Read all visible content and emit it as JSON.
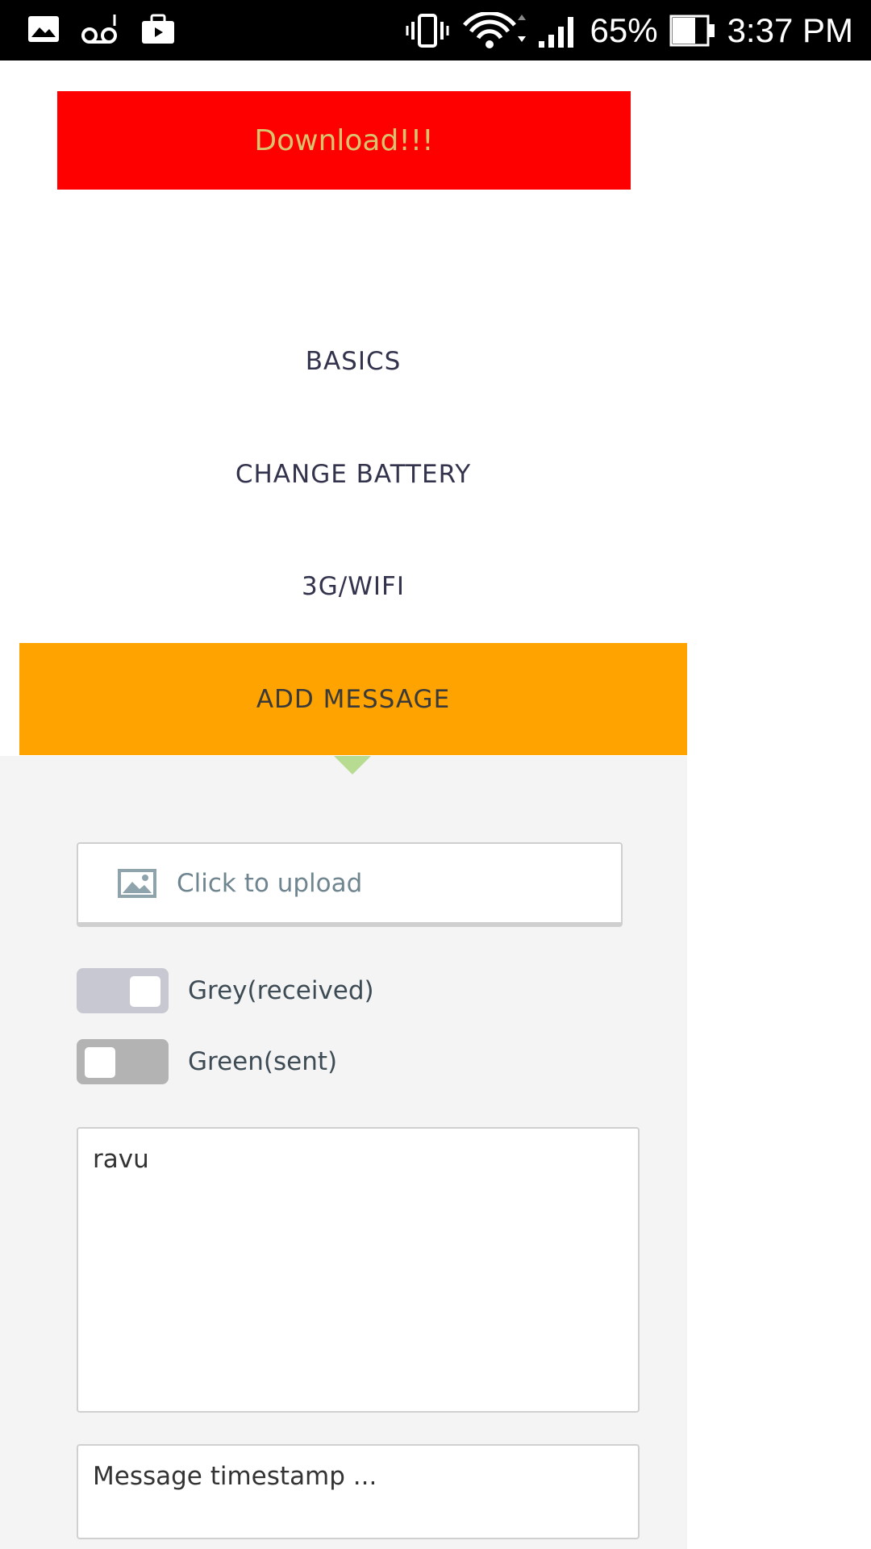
{
  "status_bar": {
    "icons_left": [
      "gallery-icon",
      "voicemail-icon",
      "briefcase-icon"
    ],
    "icons_right": [
      "vibrate-icon",
      "wifi-icon",
      "signal-icon",
      "battery-icon"
    ],
    "battery_percent": "65%",
    "time": "3:37 PM"
  },
  "download_button": {
    "label": "Download!!!",
    "background": "#ff0000",
    "text_color": "#d9c36f"
  },
  "menu": {
    "items": [
      {
        "label": "BASICS",
        "active": false
      },
      {
        "label": "CHANGE BATTERY",
        "active": false
      },
      {
        "label": "3G/WIFI",
        "active": false
      },
      {
        "label": "ADD MESSAGE",
        "active": true
      }
    ],
    "active_color": "#ffa300"
  },
  "add_message_panel": {
    "upload": {
      "label": "Click to upload",
      "icon": "image-icon"
    },
    "toggles": [
      {
        "label": "Grey(received)",
        "on": true
      },
      {
        "label": "Green(sent)",
        "on": false
      }
    ],
    "message": {
      "value": "ravu"
    },
    "timestamp": {
      "placeholder": "Message timestamp ..."
    }
  }
}
